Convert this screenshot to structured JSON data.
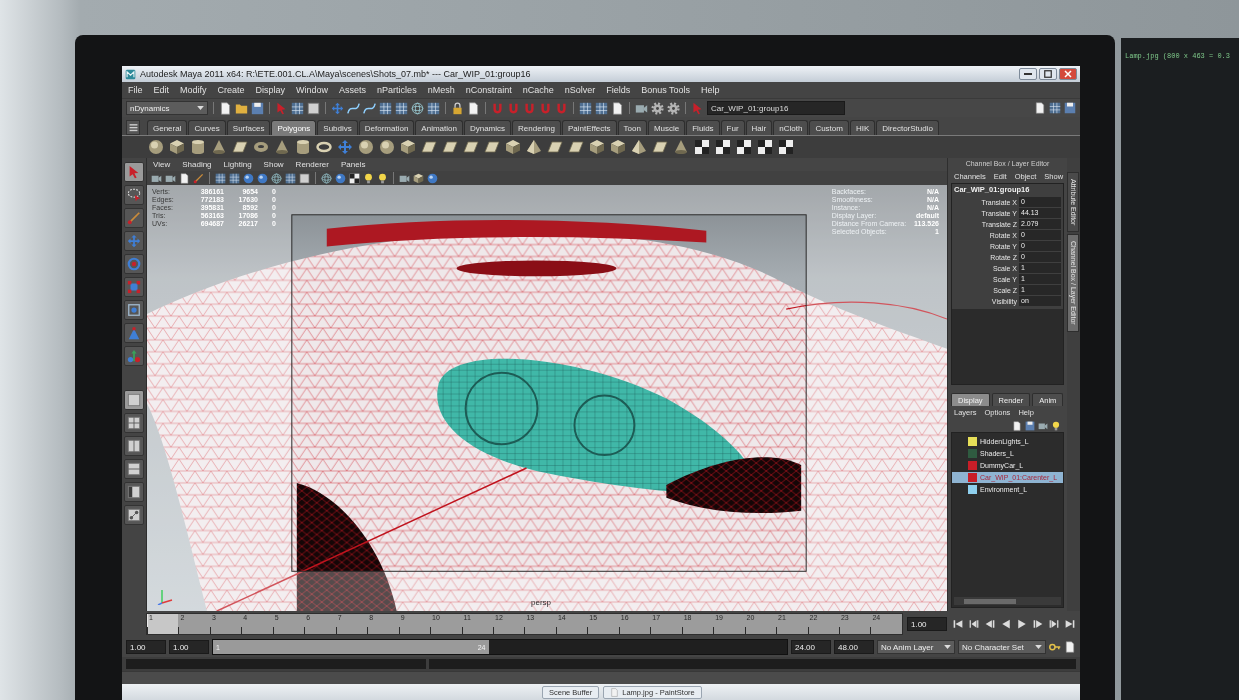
{
  "window": {
    "title": "Autodesk Maya 2011 x64: R:\\ETE.001.CL.A\\Maya\\scenes\\Shots_07.mb* --- Car_WIP_01:group16"
  },
  "menu": [
    "File",
    "Edit",
    "Modify",
    "Create",
    "Display",
    "Window",
    "Assets",
    "nParticles",
    "nMesh",
    "nConstraint",
    "nCache",
    "nSolver",
    "Fields",
    "Bonus Tools",
    "Help"
  ],
  "status_line": {
    "menu_set": "nDynamics",
    "selection_field": "Car_WIP_01:group16"
  },
  "shelf_tabs": [
    {
      "label": "General",
      "selected": false
    },
    {
      "label": "Curves",
      "selected": false
    },
    {
      "label": "Surfaces",
      "selected": false
    },
    {
      "label": "Polygons",
      "selected": true
    },
    {
      "label": "Subdivs",
      "selected": false
    },
    {
      "label": "Deformation",
      "selected": false
    },
    {
      "label": "Animation",
      "selected": false
    },
    {
      "label": "Dynamics",
      "selected": false
    },
    {
      "label": "Rendering",
      "selected": false
    },
    {
      "label": "PaintEffects",
      "selected": false
    },
    {
      "label": "Toon",
      "selected": false
    },
    {
      "label": "Muscle",
      "selected": false
    },
    {
      "label": "Fluids",
      "selected": false
    },
    {
      "label": "Fur",
      "selected": false
    },
    {
      "label": "Hair",
      "selected": false
    },
    {
      "label": "nCloth",
      "selected": false
    },
    {
      "label": "Custom",
      "selected": false
    },
    {
      "label": "HIK",
      "selected": false
    },
    {
      "label": "DirectorStudio",
      "selected": false
    }
  ],
  "toolbox": [
    {
      "kind": "select",
      "selected": true
    },
    {
      "kind": "lasso",
      "selected": false
    },
    {
      "kind": "paint",
      "selected": false
    },
    {
      "kind": "move",
      "selected": false
    },
    {
      "kind": "rotate",
      "selected": false
    },
    {
      "kind": "scale",
      "selected": false
    },
    {
      "kind": "manipulator",
      "selected": false
    },
    {
      "kind": "soft_mod",
      "selected": false
    },
    {
      "kind": "show_manip",
      "selected": false
    }
  ],
  "layouts": [
    {
      "kind": "single",
      "selected": true
    },
    {
      "kind": "four",
      "selected": false
    },
    {
      "kind": "two_side",
      "selected": false
    },
    {
      "kind": "two_stacked",
      "selected": false
    },
    {
      "kind": "outliner",
      "selected": false
    },
    {
      "kind": "nodes",
      "selected": false
    }
  ],
  "viewport": {
    "menu": [
      "View",
      "Shading",
      "Lighting",
      "Show",
      "Renderer",
      "Panels"
    ],
    "stats": [
      {
        "label": "Verts:",
        "values": [
          "386161",
          "9654",
          "0"
        ]
      },
      {
        "label": "Edges:",
        "values": [
          "772183",
          "17630",
          "0"
        ]
      },
      {
        "label": "Faces:",
        "values": [
          "395831",
          "8592",
          "0"
        ]
      },
      {
        "label": "Tris:",
        "values": [
          "563163",
          "17086",
          "0"
        ]
      },
      {
        "label": "UVs:",
        "values": [
          "694687",
          "26217",
          "0"
        ]
      }
    ],
    "hud": [
      {
        "label": "Backfaces:",
        "value": "N/A"
      },
      {
        "label": "Smoothness:",
        "value": "N/A"
      },
      {
        "label": "Instance:",
        "value": "N/A"
      },
      {
        "label": "Display Layer:",
        "value": "default"
      },
      {
        "label": "Distance From Camera:",
        "value": "113.526"
      },
      {
        "label": "Selected Objects:",
        "value": "1"
      }
    ],
    "camera": "persp"
  },
  "channel_box": {
    "title": "Channel Box / Layer Editor",
    "menu": [
      "Channels",
      "Edit",
      "Object",
      "Show"
    ],
    "object": "Car_WIP_01:group16",
    "attributes": [
      {
        "name": "Translate X",
        "value": "0"
      },
      {
        "name": "Translate Y",
        "value": "44.13"
      },
      {
        "name": "Translate Z",
        "value": "2.079"
      },
      {
        "name": "Rotate X",
        "value": "0"
      },
      {
        "name": "Rotate Y",
        "value": "0"
      },
      {
        "name": "Rotate Z",
        "value": "0"
      },
      {
        "name": "Scale X",
        "value": "1"
      },
      {
        "name": "Scale Y",
        "value": "1"
      },
      {
        "name": "Scale Z",
        "value": "1"
      },
      {
        "name": "Visibility",
        "value": "on"
      }
    ]
  },
  "layer_editor": {
    "tabs": [
      {
        "label": "Display",
        "selected": true
      },
      {
        "label": "Render",
        "selected": false
      },
      {
        "label": "Anim",
        "selected": false
      }
    ],
    "menu": [
      "Layers",
      "Options",
      "Help"
    ],
    "layers": [
      {
        "name": "HiddenLights_L",
        "color": "#e6df58",
        "selected": false
      },
      {
        "name": "Shaders_L",
        "color": "#2f5b40",
        "selected": false
      },
      {
        "name": "DummyCar_L",
        "color": "#c81e28",
        "selected": false
      },
      {
        "name": "Car_WIP_01:Carenter_L",
        "color": "#c81e28",
        "selected": true
      },
      {
        "name": "Environment_L",
        "color": "#8fd0ee",
        "selected": false
      }
    ]
  },
  "side_tabs": [
    {
      "label": "Attribute Editor",
      "selected": false
    },
    {
      "label": "Channel Box / Layer Editor",
      "selected": true
    }
  ],
  "time_slider": {
    "ticks": [
      "1",
      "2",
      "3",
      "4",
      "5",
      "6",
      "7",
      "8",
      "9",
      "10",
      "11",
      "12",
      "13",
      "14",
      "15",
      "16",
      "17",
      "18",
      "19",
      "20",
      "21",
      "22",
      "23",
      "24"
    ],
    "level": 0,
    "current_frame": "1.00"
  },
  "range_slider": {
    "start_time": "1.00",
    "playback_start": "1.00",
    "range_start": "1",
    "range_end": "24",
    "level": 0.48,
    "playback_end": "24.00",
    "end_time": "48.00",
    "anim_layer": "No Anim Layer",
    "character_set": "No Character Set"
  },
  "taskbar": [
    "Scene Buffer",
    "Lamp.jpg - PaintStore"
  ],
  "second_monitor": {
    "text": "Lamp.jpg (800 x 463 = 0.3"
  }
}
